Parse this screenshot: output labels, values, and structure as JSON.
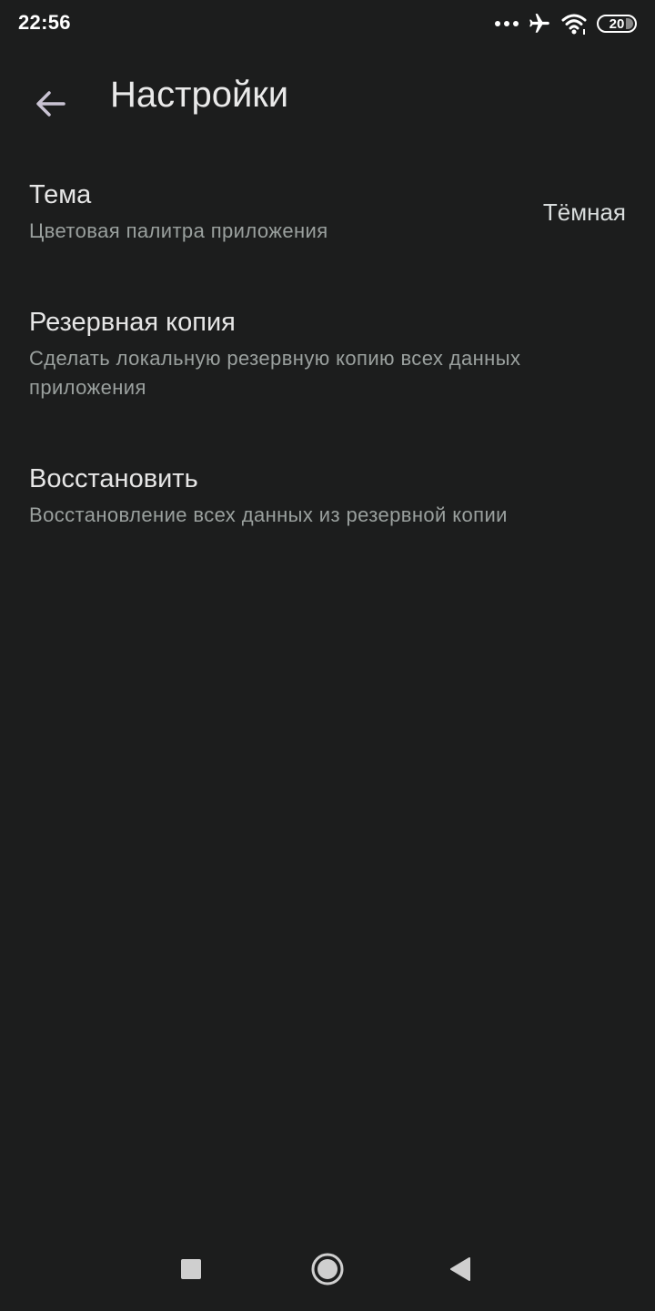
{
  "status_bar": {
    "time": "22:56",
    "battery_level": "20",
    "icons": [
      "more-dots-icon",
      "airplane-icon",
      "wifi-icon",
      "battery-icon"
    ]
  },
  "app_bar": {
    "title": "Настройки",
    "back_icon": "arrow-back-icon"
  },
  "settings": {
    "theme": {
      "title": "Тема",
      "description": "Цветовая палитра приложения",
      "value": "Тёмная"
    },
    "backup": {
      "title": "Резервная копия",
      "description": "Сделать локальную резервную копию всех данных приложения"
    },
    "restore": {
      "title": "Восстановить",
      "description": "Восстановление всех данных из резервной копии"
    }
  },
  "nav_bar": {
    "buttons": [
      "recents-square-icon",
      "home-circle-icon",
      "back-triangle-icon"
    ]
  },
  "colors": {
    "background": "#1c1d1d",
    "primary_text": "#e6e6e6",
    "secondary_text": "#9aa09e",
    "icon_tint": "#c9c3d3"
  }
}
